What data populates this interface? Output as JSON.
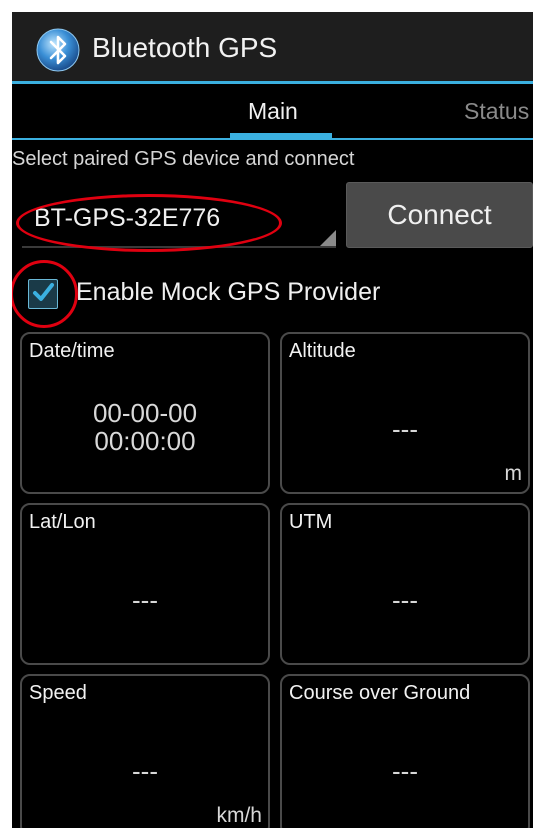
{
  "app": {
    "title": "Bluetooth GPS",
    "icon": "bluetooth-icon"
  },
  "tabs": [
    {
      "label": "Main",
      "selected": true
    },
    {
      "label": "Status",
      "selected": false
    }
  ],
  "section_label": "Select paired GPS device and connect",
  "device_spinner": {
    "selected_value": "BT-GPS-32E776"
  },
  "connect_button": {
    "label": "Connect"
  },
  "mock_gps": {
    "label": "Enable Mock GPS Provider",
    "checked": true
  },
  "tiles": {
    "datetime": {
      "label": "Date/time",
      "value_line1": "00-00-00",
      "value_line2": "00:00:00"
    },
    "altitude": {
      "label": "Altitude",
      "value": "---",
      "unit": "m"
    },
    "latlon": {
      "label": "Lat/Lon",
      "value": "---"
    },
    "utm": {
      "label": "UTM",
      "value": "---"
    },
    "speed": {
      "label": "Speed",
      "value": "---",
      "unit": "km/h"
    },
    "course": {
      "label": "Course over Ground",
      "value": "---"
    }
  },
  "colors": {
    "accent": "#3bb0e0",
    "annotation_red": "#e00010",
    "background": "#000000"
  }
}
